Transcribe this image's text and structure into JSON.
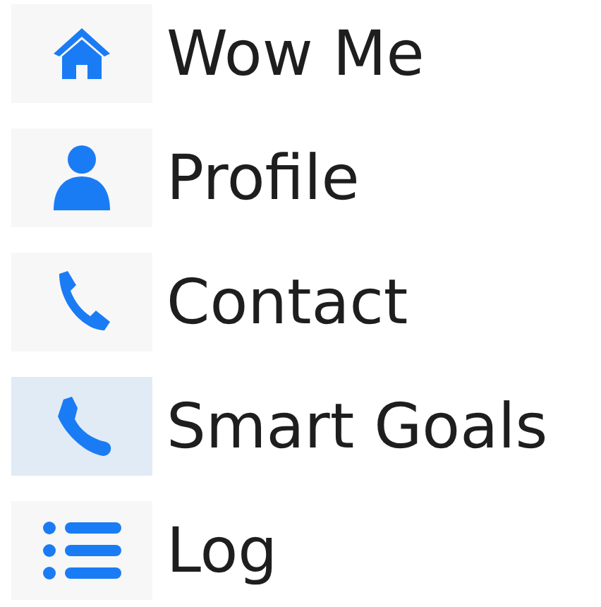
{
  "nav": [
    {
      "label": "Wow Me",
      "kind": "home",
      "selected": false
    },
    {
      "label": "Profile",
      "kind": "person",
      "selected": false
    },
    {
      "label": "Contact",
      "kind": "phone",
      "selected": false
    },
    {
      "label": "Smart Goals",
      "kind": "foot",
      "selected": true
    },
    {
      "label": "Log",
      "kind": "list",
      "selected": false
    }
  ]
}
